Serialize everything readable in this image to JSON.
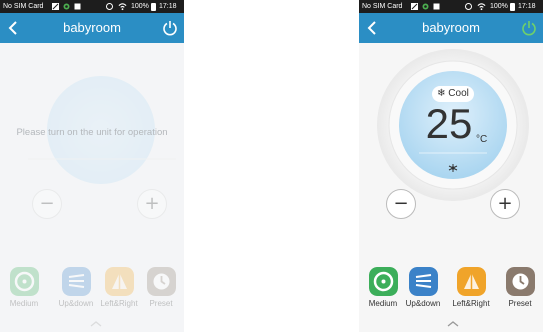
{
  "status_bar": {
    "carrier": "No SIM Card",
    "battery": "100%",
    "time": "17:18"
  },
  "header": {
    "title": "babyroom",
    "colors": {
      "background": "#2b8ec4",
      "power_off": "#ffffff",
      "power_on": "#6fd06a"
    }
  },
  "off_screen": {
    "message": "Please turn on the unit for operation",
    "power_state": "off"
  },
  "on_screen": {
    "power_state": "on",
    "mode": "Cool",
    "mode_icon": "snowflake-icon",
    "temperature": "25",
    "unit": "°C",
    "fan_indicator_icon": "fan-speed-icon"
  },
  "controls": {
    "decrease": "−",
    "increase": "+",
    "expand_icon": "chevron-up-icon"
  },
  "functions": [
    {
      "label": "Medium",
      "icon": "fan-speed-icon",
      "color": "#3cae5a"
    },
    {
      "label": "Up&down",
      "icon": "vertical-swing-icon",
      "color": "#3b82c8"
    },
    {
      "label": "Left&Right",
      "icon": "horizontal-swing-icon",
      "color": "#f0a42a"
    },
    {
      "label": "Preset",
      "icon": "clock-icon",
      "color": "#8a7a6d"
    }
  ]
}
